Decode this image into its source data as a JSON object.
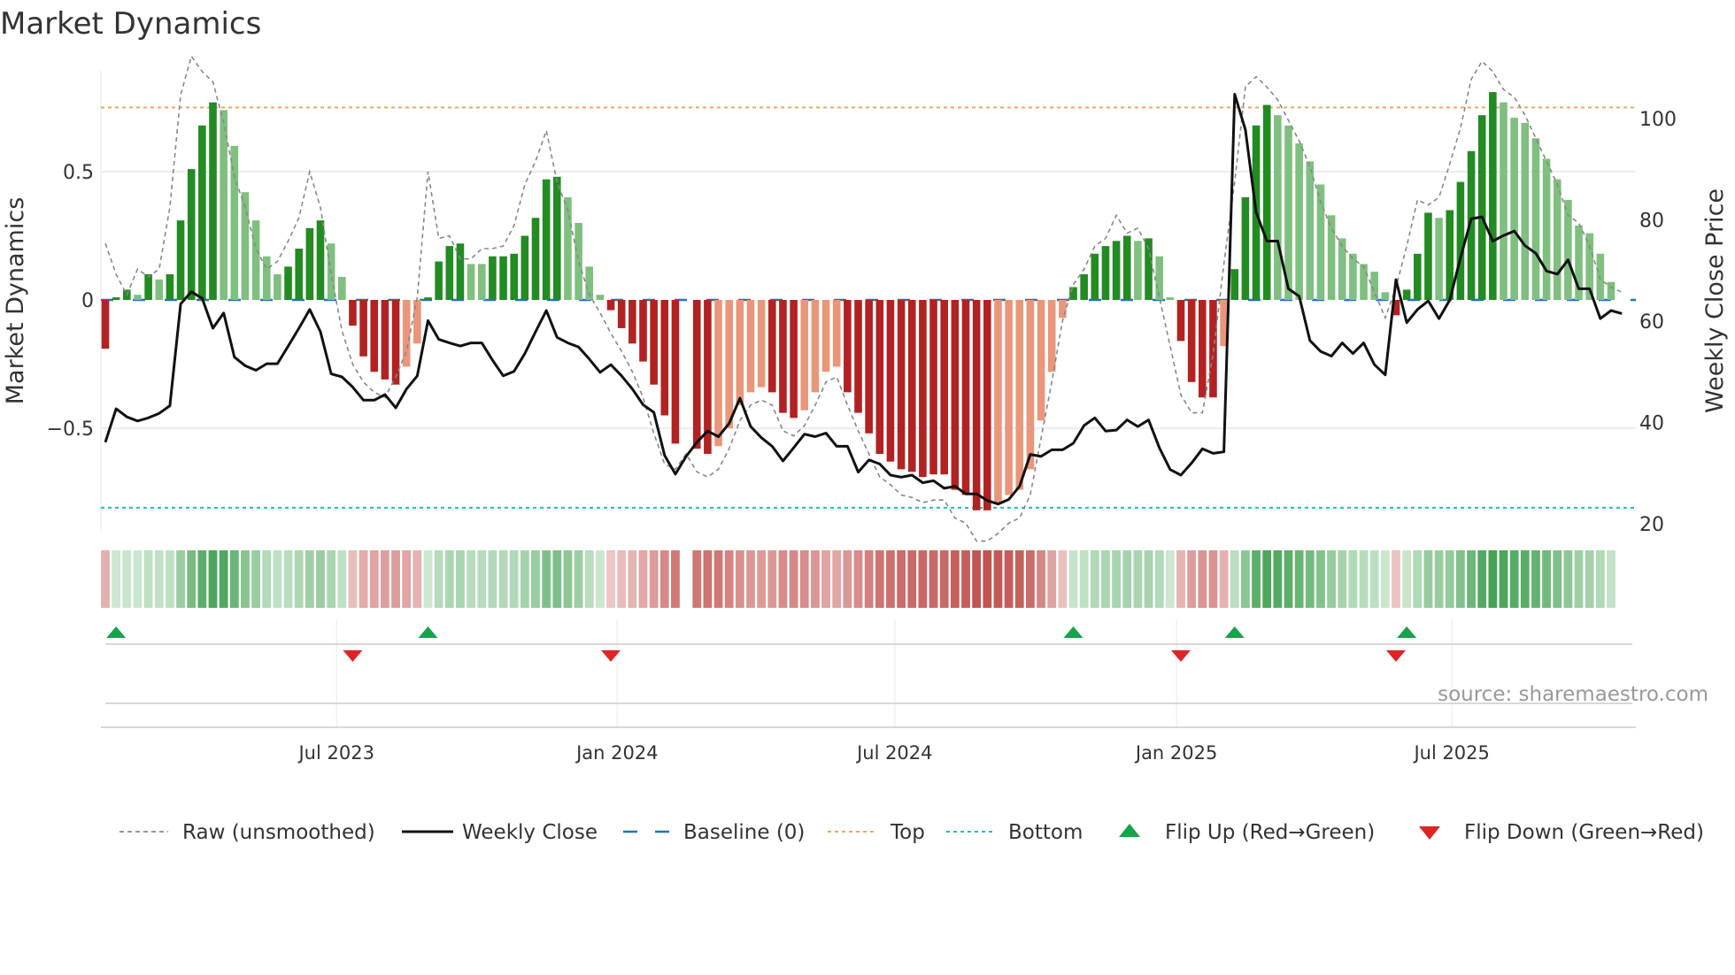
{
  "chart_data": {
    "type": "bar",
    "title": "Market Dynamics",
    "ylabel": "Market Dynamics",
    "y2label": "Weekly Close Price",
    "ylim": [
      -0.92,
      0.92
    ],
    "y2lim": [
      18,
      106
    ],
    "yticks": [
      {
        "v": 0.5,
        "label": "0.5"
      },
      {
        "v": 0,
        "label": "0"
      },
      {
        "v": -0.5,
        "label": "−0.5"
      }
    ],
    "y2ticks": [
      {
        "v": 100,
        "label": "100"
      },
      {
        "v": 80,
        "label": "80"
      },
      {
        "v": 60,
        "label": "60"
      },
      {
        "v": 40,
        "label": "40"
      },
      {
        "v": 20,
        "label": "20"
      }
    ],
    "xticks": [
      {
        "week": 21.5,
        "label": "Jul 2023"
      },
      {
        "week": 47.6,
        "label": "Jan 2024"
      },
      {
        "week": 73.4,
        "label": "Jul 2024"
      },
      {
        "week": 99.6,
        "label": "Jan 2025"
      },
      {
        "week": 125.2,
        "label": "Jul 2025"
      }
    ],
    "x_unit": "weekly index (approx. Feb 2023 – Oct 2025)",
    "top_level": 0.75,
    "bottom_level": -0.81,
    "baseline": 0,
    "momentum": [
      -0.19,
      0.01,
      0.04,
      0.02,
      0.1,
      0.08,
      0.1,
      0.31,
      0.51,
      0.68,
      0.77,
      0.74,
      0.6,
      0.42,
      0.31,
      0.17,
      0.1,
      0.13,
      0.2,
      0.28,
      0.31,
      0.22,
      0.09,
      -0.1,
      -0.22,
      -0.28,
      -0.31,
      -0.33,
      -0.26,
      -0.17,
      0.01,
      0.15,
      0.21,
      0.22,
      0.14,
      0.14,
      0.17,
      0.17,
      0.18,
      0.25,
      0.32,
      0.47,
      0.48,
      0.4,
      0.3,
      0.13,
      0.02,
      -0.04,
      -0.11,
      -0.17,
      -0.24,
      -0.33,
      -0.45,
      -0.56,
      null,
      -0.58,
      -0.6,
      -0.57,
      -0.5,
      -0.41,
      -0.36,
      -0.34,
      -0.36,
      -0.44,
      -0.46,
      -0.43,
      -0.36,
      -0.28,
      -0.26,
      -0.36,
      -0.44,
      -0.52,
      -0.6,
      -0.63,
      -0.66,
      -0.67,
      -0.69,
      -0.68,
      -0.68,
      -0.74,
      -0.76,
      -0.82,
      -0.82,
      -0.79,
      -0.76,
      -0.74,
      -0.66,
      -0.47,
      -0.28,
      -0.07,
      0.05,
      0.1,
      0.18,
      0.21,
      0.23,
      0.25,
      0.23,
      0.24,
      0.17,
      0.01,
      -0.16,
      -0.32,
      -0.38,
      -0.38,
      -0.18,
      0.12,
      0.4,
      0.68,
      0.76,
      0.72,
      0.68,
      0.61,
      0.54,
      0.45,
      0.33,
      0.24,
      0.18,
      0.14,
      0.11,
      0.03,
      -0.06,
      0.04,
      0.18,
      0.34,
      0.32,
      0.35,
      0.46,
      0.58,
      0.72,
      0.81,
      0.77,
      0.71,
      0.69,
      0.63,
      0.55,
      0.47,
      0.39,
      0.29,
      0.26,
      0.18,
      0.07
    ],
    "momentum_shade": [
      "R",
      "G",
      "G",
      "g",
      "G",
      "g",
      "G",
      "G",
      "G",
      "G",
      "G",
      "g",
      "g",
      "g",
      "g",
      "g",
      "g",
      "G",
      "G",
      "G",
      "G",
      "g",
      "g",
      "R",
      "R",
      "R",
      "R",
      "R",
      "r",
      "r",
      "G",
      "G",
      "G",
      "G",
      "g",
      "g",
      "G",
      "G",
      "G",
      "G",
      "G",
      "G",
      "G",
      "g",
      "g",
      "g",
      "g",
      "R",
      "R",
      "R",
      "R",
      "R",
      "R",
      "R",
      "",
      "R",
      "R",
      "r",
      "r",
      "r",
      "r",
      "r",
      "R",
      "R",
      "R",
      "r",
      "r",
      "r",
      "r",
      "R",
      "R",
      "R",
      "R",
      "R",
      "R",
      "R",
      "R",
      "R",
      "R",
      "R",
      "R",
      "R",
      "R",
      "r",
      "r",
      "r",
      "r",
      "r",
      "r",
      "r",
      "G",
      "G",
      "G",
      "G",
      "G",
      "G",
      "g",
      "G",
      "g",
      "g",
      "R",
      "R",
      "R",
      "R",
      "r",
      "G",
      "G",
      "G",
      "G",
      "g",
      "g",
      "g",
      "g",
      "g",
      "g",
      "g",
      "g",
      "g",
      "g",
      "g",
      "R",
      "G",
      "G",
      "G",
      "g",
      "G",
      "G",
      "G",
      "G",
      "G",
      "g",
      "g",
      "g",
      "g",
      "g",
      "g",
      "g",
      "g",
      "g",
      "g",
      "g"
    ],
    "raw": [
      0.22,
      0.1,
      0.02,
      0.12,
      0.09,
      0.12,
      0.36,
      0.8,
      0.95,
      0.89,
      0.85,
      0.69,
      0.48,
      0.36,
      0.2,
      0.12,
      0.15,
      0.23,
      0.32,
      0.5,
      0.36,
      0.1,
      -0.12,
      -0.25,
      -0.32,
      -0.36,
      -0.38,
      -0.3,
      -0.2,
      0.01,
      0.5,
      0.24,
      0.25,
      0.16,
      0.16,
      0.2,
      0.2,
      0.21,
      0.29,
      0.45,
      0.54,
      0.66,
      0.46,
      0.35,
      0.15,
      0.02,
      -0.05,
      -0.13,
      -0.2,
      -0.28,
      -0.38,
      -0.52,
      -0.64,
      -0.66,
      -0.6,
      -0.67,
      -0.69,
      -0.66,
      -0.58,
      -0.47,
      -0.41,
      -0.39,
      -0.41,
      -0.51,
      -0.53,
      -0.49,
      -0.41,
      -0.32,
      -0.3,
      -0.41,
      -0.51,
      -0.6,
      -0.69,
      -0.72,
      -0.76,
      -0.77,
      -0.79,
      -0.78,
      -0.78,
      -0.85,
      -0.87,
      -0.94,
      -0.94,
      -0.91,
      -0.87,
      -0.85,
      -0.76,
      -0.54,
      -0.32,
      -0.08,
      0.06,
      0.12,
      0.21,
      0.24,
      0.33,
      0.26,
      0.28,
      0.2,
      0.01,
      -0.18,
      -0.37,
      -0.44,
      -0.44,
      -0.21,
      0.14,
      0.46,
      0.83,
      0.87,
      0.83,
      0.78,
      0.7,
      0.62,
      0.52,
      0.38,
      0.28,
      0.21,
      0.16,
      0.13,
      0.03,
      -0.07,
      0.05,
      0.21,
      0.39,
      0.37,
      0.4,
      0.53,
      0.67,
      0.86,
      0.93,
      0.89,
      0.82,
      0.79,
      0.72,
      0.63,
      0.54,
      0.45,
      0.33,
      0.3,
      0.21,
      0.08,
      0.05,
      0.03
    ],
    "weekly_close": [
      36.1,
      42.7,
      41.1,
      40.3,
      40.9,
      41.8,
      43.3,
      63.4,
      65.8,
      64.5,
      58.6,
      61.6,
      52.9,
      51.2,
      50.3,
      51.6,
      51.6,
      55.1,
      58.6,
      62.3,
      57.9,
      49.6,
      49.0,
      47.0,
      44.4,
      44.4,
      45.5,
      42.9,
      46.6,
      49.2,
      60.1,
      56.4,
      55.7,
      55.1,
      55.7,
      55.7,
      52.3,
      49.2,
      50.1,
      53.6,
      57.9,
      62.1,
      56.8,
      55.7,
      54.9,
      52.5,
      49.9,
      51.4,
      49.2,
      46.6,
      43.5,
      42.0,
      33.5,
      29.8,
      33.3,
      36.1,
      38.3,
      37.2,
      39.8,
      44.8,
      39.2,
      37.0,
      35.3,
      32.4,
      35.0,
      37.7,
      37.2,
      37.9,
      35.3,
      35.3,
      30.2,
      32.6,
      31.8,
      29.6,
      29.2,
      29.6,
      28.1,
      28.5,
      27.0,
      27.4,
      25.9,
      25.9,
      24.6,
      23.9,
      24.8,
      27.4,
      33.7,
      33.3,
      34.6,
      34.6,
      35.9,
      39.4,
      40.9,
      38.3,
      38.5,
      40.5,
      39.2,
      40.5,
      35.0,
      30.7,
      29.6,
      32.0,
      34.8,
      33.9,
      34.2,
      104.8,
      97.8,
      81.5,
      75.8,
      75.8,
      66.4,
      64.9,
      56.2,
      54.0,
      53.1,
      55.7,
      53.6,
      55.7,
      51.4,
      49.4,
      68.2,
      59.7,
      62.3,
      64.0,
      60.5,
      64.2,
      72.5,
      80.2,
      80.6,
      75.8,
      76.9,
      77.8,
      74.9,
      73.4,
      69.9,
      69.3,
      72.1,
      66.4,
      66.4,
      60.5,
      62.1,
      61.5
    ],
    "flip_up_weeks": [
      1,
      30,
      90,
      105,
      121
    ],
    "flip_down_weeks": [
      23,
      47,
      100,
      120
    ],
    "colors": {
      "strong_green": "#228b22",
      "light_green": "#7fbf7f",
      "strong_red": "#b22222",
      "light_red": "#e9967a",
      "baseline": "#1f77b4",
      "top": "#f4a460",
      "bottom": "#17becf",
      "flip_up": "#16a34a",
      "flip_down": "#dc2626"
    },
    "legend": {
      "placement": "bottom",
      "items": [
        {
          "key": "raw",
          "label": "Raw (unsmoothed)"
        },
        {
          "key": "close",
          "label": "Weekly Close"
        },
        {
          "key": "baseline",
          "label": "Baseline (0)"
        },
        {
          "key": "top",
          "label": "Top"
        },
        {
          "key": "bottom",
          "label": "Bottom"
        },
        {
          "key": "flip_up",
          "label": "Flip Up (Red→Green)"
        },
        {
          "key": "flip_down",
          "label": "Flip Down (Green→Red)"
        }
      ]
    },
    "source": "source: sharemaestro.com"
  }
}
